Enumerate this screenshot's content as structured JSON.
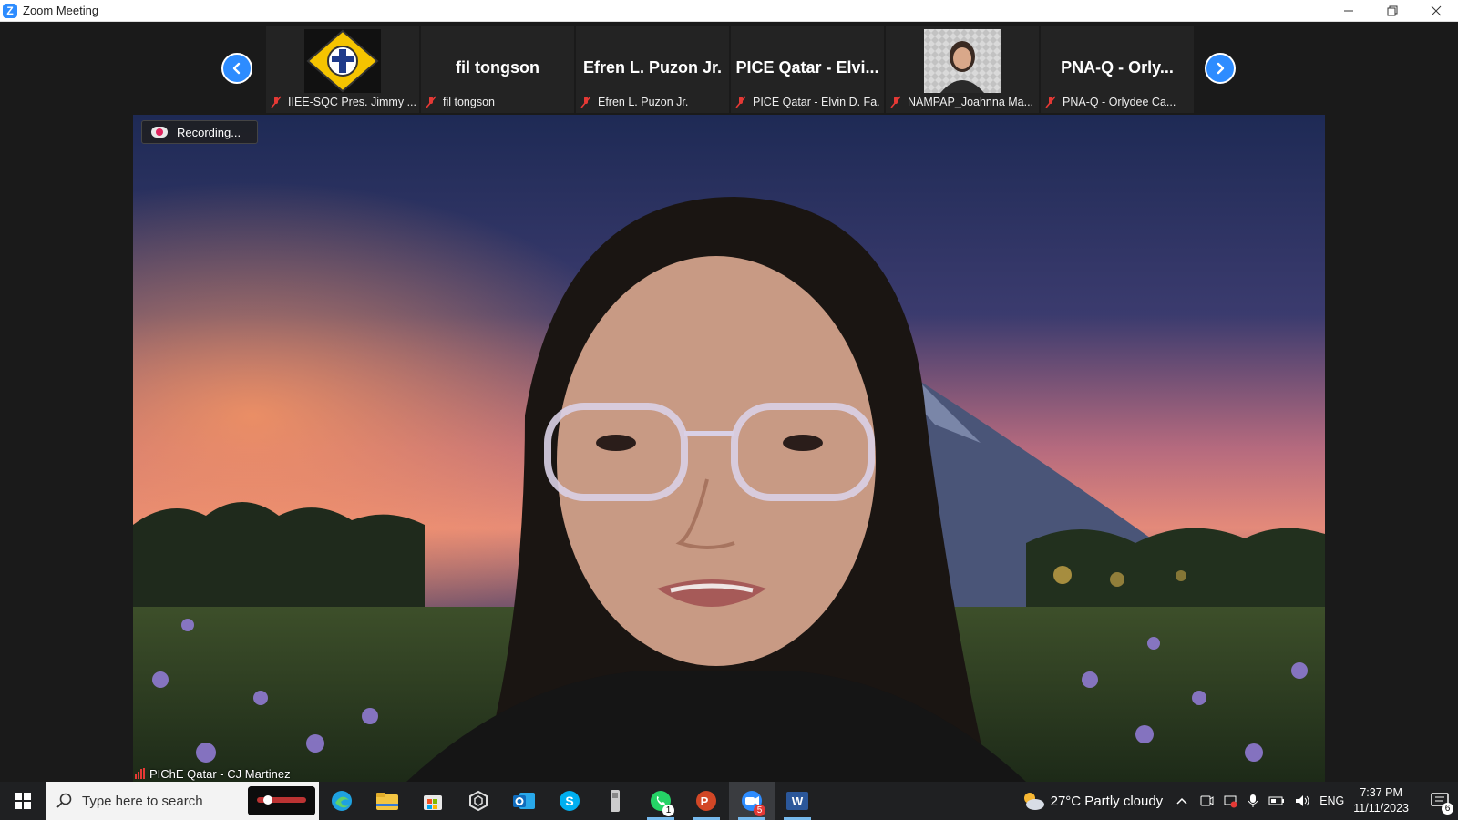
{
  "window": {
    "title": "Zoom Meeting",
    "app_icon_letter": "Z"
  },
  "gallery": {
    "prev_icon": "chevron-left-icon",
    "next_icon": "chevron-right-icon",
    "participants": [
      {
        "display_name": "",
        "caption": "IIEE-SQC Pres. Jimmy ...",
        "has_image": "logo",
        "muted": true
      },
      {
        "display_name": "fil tongson",
        "caption": "fil tongson",
        "muted": true
      },
      {
        "display_name": "Efren L. Puzon Jr.",
        "caption": "Efren L. Puzon Jr.",
        "muted": true
      },
      {
        "display_name": "PICE Qatar - Elvi...",
        "caption": "PICE Qatar - Elvin D. Fa...",
        "muted": true
      },
      {
        "display_name": "",
        "caption": "NAMPAP_Joahnna Ma...",
        "has_image": "video",
        "muted": true
      },
      {
        "display_name": "PNA-Q  -  Orly...",
        "caption": "PNA-Q  -  Orlydee Ca...",
        "muted": true
      }
    ]
  },
  "recording": {
    "label": "Recording..."
  },
  "active_speaker": {
    "label": "PIChE Qatar - CJ Martinez"
  },
  "taskbar": {
    "search_placeholder": "Type here to search",
    "apps": [
      "edge-icon",
      "file-explorer-icon",
      "store-icon",
      "app-icon",
      "outlook-icon",
      "skype-icon",
      "device-icon",
      "whatsapp-icon",
      "powerpoint-icon",
      "zoom-icon",
      "word-icon"
    ],
    "whatsapp_badge": "1",
    "zoom_badge": "5",
    "weather": "27°C  Partly cloudy",
    "language": "ENG",
    "time": "7:37 PM",
    "date": "11/11/2023",
    "notification_count": "6"
  },
  "colors": {
    "accent": "#2d8cff",
    "muted_red": "#e53935"
  }
}
